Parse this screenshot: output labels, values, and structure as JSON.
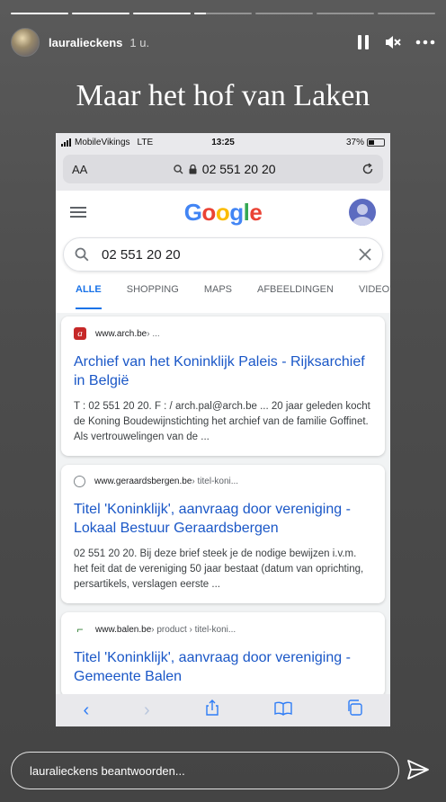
{
  "story": {
    "progress_fill": [
      1,
      1,
      1,
      0.2,
      0,
      0,
      0
    ],
    "username": "lauralieckens",
    "time_ago": "1 u.",
    "caption": "Maar het hof van Laken",
    "reply_placeholder": "lauralieckens beantwoorden..."
  },
  "ios_status": {
    "carrier": "MobileVikings",
    "network": "LTE",
    "clock": "13:25",
    "battery": "37%"
  },
  "safari": {
    "aa_label": "AA",
    "url_text": "02 551 20 20"
  },
  "google": {
    "logo": [
      "G",
      "o",
      "o",
      "g",
      "l",
      "e"
    ],
    "query": "02 551 20 20",
    "tabs": [
      "ALLE",
      "SHOPPING",
      "MAPS",
      "AFBEELDINGEN",
      "VIDEO'S"
    ],
    "active_tab": "ALLE",
    "results": [
      {
        "domain": "www.arch.be",
        "path": " › ...",
        "title": "Archief van het Koninklijk Paleis - Rijksarchief in België",
        "snippet": "T : 02 551 20 20. F : / arch.pal@arch.be ... 20 jaar geleden kocht de Koning Boudewijnstichting het archief van de familie Goffinet. Als vertrouwelingen van de ..."
      },
      {
        "domain": "www.geraardsbergen.be",
        "path": " › titel-koni...",
        "title": "Titel 'Koninklijk', aanvraag door vereniging - Lokaal Bestuur Geraardsbergen",
        "snippet": "02 551 20 20. Bij deze brief steek je de nodige bewijzen i.v.m. het feit dat de vereniging 50 jaar bestaat (datum van oprichting, persartikels, verslagen eerste ..."
      },
      {
        "domain": "www.balen.be",
        "path": " › product › titel-koni...",
        "title": "Titel 'Koninklijk', aanvraag door vereniging - Gemeente Balen",
        "snippet": ""
      }
    ]
  },
  "colors": {
    "google_blue": "#4285f4",
    "link_blue": "#1a57c7",
    "active_tab": "#1a73e8"
  }
}
